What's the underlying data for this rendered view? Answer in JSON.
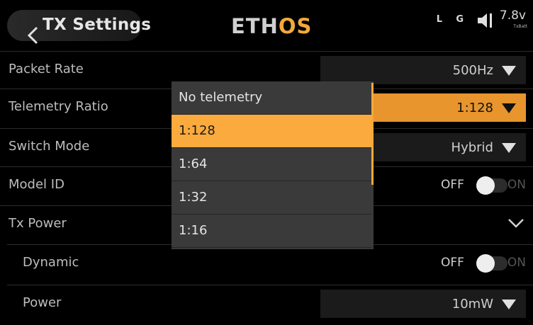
{
  "header": {
    "title": "TX Settings",
    "logo_main": "ETH",
    "logo_accent": "OS",
    "status_l": "L",
    "status_g": "G",
    "voltage": "7.8v",
    "voltage_sub": "TxBatt",
    "accent_color": "#f2a93b"
  },
  "rows": [
    {
      "label": "Packet Rate",
      "value": "500Hz"
    },
    {
      "label": "Telemetry Ratio",
      "value": "1:128"
    },
    {
      "label": "Switch Mode",
      "value": "Hybrid"
    },
    {
      "label": "Model ID",
      "toggle_off": "OFF",
      "toggle_on": "ON"
    },
    {
      "label": "Tx Power"
    },
    {
      "label": "Dynamic",
      "toggle_off": "OFF",
      "toggle_on": "ON"
    },
    {
      "label": "Power",
      "value": "10mW"
    }
  ],
  "dropdown": {
    "options": [
      "No telemetry",
      "1:128",
      "1:64",
      "1:32",
      "1:16"
    ],
    "selected": "1:128"
  }
}
